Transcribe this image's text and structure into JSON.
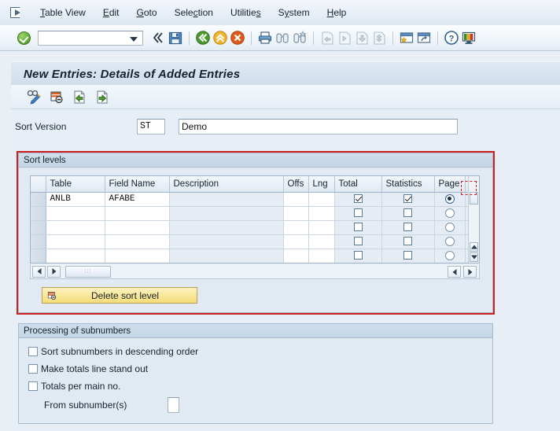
{
  "menubar": {
    "system_icon": "window-menu-icon",
    "items": [
      {
        "label": "Table View",
        "accel_index": 1
      },
      {
        "label": "Edit",
        "accel_index": 0
      },
      {
        "label": "Goto",
        "accel_index": 0
      },
      {
        "label": "Selection",
        "accel_index": 3
      },
      {
        "label": "Utilities",
        "accel_index": 7
      },
      {
        "label": "System",
        "accel_index": 1
      },
      {
        "label": "Help",
        "accel_index": 0
      }
    ]
  },
  "toolbar": {
    "enter_icon": "green-check-enter-icon",
    "command_field_value": "",
    "command_field_placeholder": "",
    "dropdown_icon": "chevron-down-icon",
    "collapse_icon": "double-chevron-left-icon",
    "items": [
      {
        "name": "save-icon",
        "label": "Save"
      },
      {
        "name": "back-icon",
        "label": "Back"
      },
      {
        "name": "exit-icon",
        "label": "Exit"
      },
      {
        "name": "cancel-icon",
        "label": "Cancel"
      },
      {
        "name": "print-icon",
        "label": "Print"
      },
      {
        "name": "find-icon",
        "label": "Find"
      },
      {
        "name": "find-next-icon",
        "label": "Find Next"
      },
      {
        "name": "first-page-icon",
        "label": "First Page"
      },
      {
        "name": "previous-page-icon",
        "label": "Previous Page"
      },
      {
        "name": "next-page-icon",
        "label": "Next Page"
      },
      {
        "name": "last-page-icon",
        "label": "Last Page"
      },
      {
        "name": "create-session-icon",
        "label": "Create Session"
      },
      {
        "name": "create-shortcut-icon",
        "label": "Create Shortcut"
      },
      {
        "name": "help-icon",
        "label": "Help"
      },
      {
        "name": "customize-local-layout-icon",
        "label": "Customize Local Layout"
      }
    ]
  },
  "window": {
    "title": "New Entries: Details of Added Entries"
  },
  "app_toolbar": {
    "items": [
      {
        "name": "display-change-icon",
        "label": "Display/Change"
      },
      {
        "name": "delete-entry-icon",
        "label": "Delete Entry"
      },
      {
        "name": "previous-entry-icon",
        "label": "Previous Entry"
      },
      {
        "name": "next-entry-icon",
        "label": "Next Entry"
      }
    ]
  },
  "sort_version": {
    "label": "Sort Version",
    "key_value": "ST",
    "description_value": "Demo",
    "description_placeholder": ""
  },
  "sort_levels": {
    "title": "Sort levels",
    "column_config_icon": "table-settings-icon",
    "columns": [
      {
        "label": "",
        "name": "row-selector"
      },
      {
        "label": "Table",
        "name": "column-table"
      },
      {
        "label": "Field Name",
        "name": "column-field-name"
      },
      {
        "label": "Description",
        "name": "column-description"
      },
      {
        "label": "Offs",
        "name": "column-offs"
      },
      {
        "label": "Lng",
        "name": "column-lng"
      },
      {
        "label": "Total",
        "name": "column-total"
      },
      {
        "label": "Statistics",
        "name": "column-statistics"
      },
      {
        "label": "Page",
        "name": "column-page"
      }
    ],
    "rows": [
      {
        "table": "ANLB",
        "field_name": "AFABE",
        "description": "",
        "offs": "",
        "lng": "",
        "total": true,
        "statistics": true,
        "page": true
      },
      {
        "table": "",
        "field_name": "",
        "description": "",
        "offs": "",
        "lng": "",
        "total": false,
        "statistics": false,
        "page": false
      },
      {
        "table": "",
        "field_name": "",
        "description": "",
        "offs": "",
        "lng": "",
        "total": false,
        "statistics": false,
        "page": false
      },
      {
        "table": "",
        "field_name": "",
        "description": "",
        "offs": "",
        "lng": "",
        "total": false,
        "statistics": false,
        "page": false
      },
      {
        "table": "",
        "field_name": "",
        "description": "",
        "offs": "",
        "lng": "",
        "total": false,
        "statistics": false,
        "page": false
      }
    ],
    "delete_button": {
      "label": "Delete sort level",
      "icon": "delete-row-icon"
    },
    "scroll": {
      "left_icon": "arrow-left-icon",
      "right_icon": "arrow-right-icon",
      "up_icon": "arrow-up-icon",
      "down_icon": "arrow-down-icon"
    }
  },
  "subnumbers": {
    "title": "Processing of subnumbers",
    "options": [
      {
        "label": "Sort subnumbers in descending order",
        "checked": false,
        "name": "sort-subnumbers-descending-checkbox"
      },
      {
        "label": "Make totals line stand out",
        "checked": false,
        "name": "make-totals-line-stand-out-checkbox"
      },
      {
        "label": "Totals per main no.",
        "checked": false,
        "name": "totals-per-main-no-checkbox"
      }
    ],
    "from_subnumber": {
      "label": "From subnumber(s)",
      "value": ""
    }
  },
  "annotation": {
    "highlight_color": "#cc1f1f"
  }
}
